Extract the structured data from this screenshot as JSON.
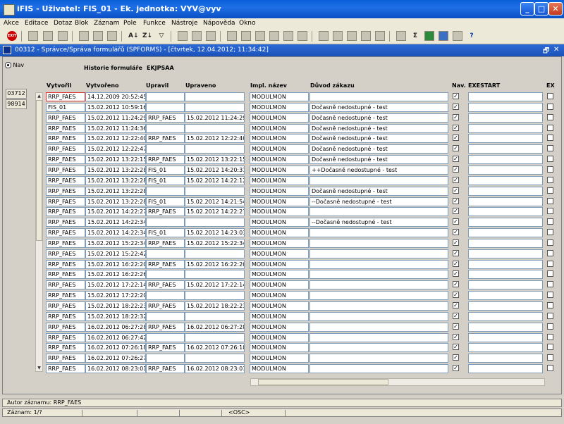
{
  "window": {
    "title": "iFIS - Uživatel: FIS_01 - Ek. jednotka: VYV@vyv",
    "min_label": "_",
    "max_label": "□",
    "close_label": "✕"
  },
  "menu": [
    "Akce",
    "Editace",
    "Dotaz",
    "Blok",
    "Záznam",
    "Pole",
    "Funkce",
    "Nástroje",
    "Nápověda",
    "Okno"
  ],
  "toolbar": {
    "exit_label": "EXIT",
    "sort_asc": "A↓",
    "sort_desc": "Z↓",
    "filter": "▽",
    "sigma": "Σ",
    "help": "?"
  },
  "form": {
    "title": "00312 - Správce/Správa formulářů (SPFORMS) - [čtvrtek, 12.04.2012; 11:34:42]",
    "restore_label": "🗗",
    "close_label": "✕",
    "nav_label": "Nav",
    "left_buttons": [
      "03712",
      "98914"
    ],
    "history_label": "Historie formuláře",
    "history_value": "EKJPSAA"
  },
  "columns": {
    "created_by": "Vytvořil",
    "created": "Vytvořeno",
    "modified_by": "Upravil",
    "modified": "Upraveno",
    "impl_name": "Impl. název",
    "reason": "Důvod zákazu",
    "nav": "Nav.",
    "exestart": "EXESTART",
    "ex": "EX"
  },
  "rows": [
    {
      "created_by": "RRP_FAES",
      "created": "14.12.2009 20:52:45",
      "modified_by": "",
      "modified": "",
      "impl": "MODULMON",
      "reason": ""
    },
    {
      "created_by": "FIS_01",
      "created": "15.02.2012 10:59:16",
      "modified_by": "",
      "modified": "",
      "impl": "MODULMON",
      "reason": "Dočasně nedostupné - test"
    },
    {
      "created_by": "RRP_FAES",
      "created": "15.02.2012 11:24:29",
      "modified_by": "RRP_FAES",
      "modified": "15.02.2012 11:24:29",
      "impl": "MODULMON",
      "reason": "Dočasně nedostupné - test"
    },
    {
      "created_by": "RRP_FAES",
      "created": "15.02.2012 11:24:36",
      "modified_by": "",
      "modified": "",
      "impl": "MODULMON",
      "reason": "Dočasně nedostupné - test"
    },
    {
      "created_by": "RRP_FAES",
      "created": "15.02.2012 12:22:40",
      "modified_by": "RRP_FAES",
      "modified": "15.02.2012 12:22:40",
      "impl": "MODULMON",
      "reason": "Dočasně nedostupné - test"
    },
    {
      "created_by": "RRP_FAES",
      "created": "15.02.2012 12:22:47",
      "modified_by": "",
      "modified": "",
      "impl": "MODULMON",
      "reason": "Dočasně nedostupné - test"
    },
    {
      "created_by": "RRP_FAES",
      "created": "15.02.2012 13:22:15",
      "modified_by": "RRP_FAES",
      "modified": "15.02.2012 13:22:15",
      "impl": "MODULMON",
      "reason": "Dočasně nedostupné - test"
    },
    {
      "created_by": "RRP_FAES",
      "created": "15.02.2012 13:22:28",
      "modified_by": "FIS_01",
      "modified": "15.02.2012 14:20:31",
      "impl": "MODULMON",
      "reason": "++Dočasně nedostupné - test"
    },
    {
      "created_by": "RRP_FAES",
      "created": "15.02.2012 13:22:28",
      "modified_by": "FIS_01",
      "modified": "15.02.2012 14:22:12",
      "impl": "MODULMON",
      "reason": ""
    },
    {
      "created_by": "RRP_FAES",
      "created": "15.02.2012 13:22:28",
      "modified_by": "",
      "modified": "",
      "impl": "MODULMON",
      "reason": "Dočasně nedostupné - test"
    },
    {
      "created_by": "RRP_FAES",
      "created": "15.02.2012 13:22:28",
      "modified_by": "FIS_01",
      "modified": "15.02.2012 14:21:54",
      "impl": "MODULMON",
      "reason": "--Dočasně nedostupné - test"
    },
    {
      "created_by": "RRP_FAES",
      "created": "15.02.2012 14:22:27",
      "modified_by": "RRP_FAES",
      "modified": "15.02.2012 14:22:27",
      "impl": "MODULMON",
      "reason": ""
    },
    {
      "created_by": "RRP_FAES",
      "created": "15.02.2012 14:22:34",
      "modified_by": "",
      "modified": "",
      "impl": "MODULMON",
      "reason": "--Dočasně nedostupné - test"
    },
    {
      "created_by": "RRP_FAES",
      "created": "15.02.2012 14:22:34",
      "modified_by": "FIS_01",
      "modified": "15.02.2012 14:23:03",
      "impl": "MODULMON",
      "reason": ""
    },
    {
      "created_by": "RRP_FAES",
      "created": "15.02.2012 15:22:34",
      "modified_by": "RRP_FAES",
      "modified": "15.02.2012 15:22:34",
      "impl": "MODULMON",
      "reason": ""
    },
    {
      "created_by": "RRP_FAES",
      "created": "15.02.2012 15:22:42",
      "modified_by": "",
      "modified": "",
      "impl": "MODULMON",
      "reason": ""
    },
    {
      "created_by": "RRP_FAES",
      "created": "15.02.2012 16:22:20",
      "modified_by": "RRP_FAES",
      "modified": "15.02.2012 16:22:20",
      "impl": "MODULMON",
      "reason": ""
    },
    {
      "created_by": "RRP_FAES",
      "created": "15.02.2012 16:22:26",
      "modified_by": "",
      "modified": "",
      "impl": "MODULMON",
      "reason": ""
    },
    {
      "created_by": "RRP_FAES",
      "created": "15.02.2012 17:22:14",
      "modified_by": "RRP_FAES",
      "modified": "15.02.2012 17:22:14",
      "impl": "MODULMON",
      "reason": ""
    },
    {
      "created_by": "RRP_FAES",
      "created": "15.02.2012 17:22:20",
      "modified_by": "",
      "modified": "",
      "impl": "MODULMON",
      "reason": ""
    },
    {
      "created_by": "RRP_FAES",
      "created": "15.02.2012 18:22:23",
      "modified_by": "RRP_FAES",
      "modified": "15.02.2012 18:22:23",
      "impl": "MODULMON",
      "reason": ""
    },
    {
      "created_by": "RRP_FAES",
      "created": "15.02.2012 18:22:32",
      "modified_by": "",
      "modified": "",
      "impl": "MODULMON",
      "reason": ""
    },
    {
      "created_by": "RRP_FAES",
      "created": "16.02.2012 06:27:28",
      "modified_by": "RRP_FAES",
      "modified": "16.02.2012 06:27:28",
      "impl": "MODULMON",
      "reason": ""
    },
    {
      "created_by": "RRP_FAES",
      "created": "16.02.2012 06:27:42",
      "modified_by": "",
      "modified": "",
      "impl": "MODULMON",
      "reason": ""
    },
    {
      "created_by": "RRP_FAES",
      "created": "16.02.2012 07:26:18",
      "modified_by": "RRP_FAES",
      "modified": "16.02.2012 07:26:18",
      "impl": "MODULMON",
      "reason": ""
    },
    {
      "created_by": "RRP_FAES",
      "created": "16.02.2012 07:26:27",
      "modified_by": "",
      "modified": "",
      "impl": "MODULMON",
      "reason": ""
    },
    {
      "created_by": "RRP_FAES",
      "created": "16.02.2012 08:23:01",
      "modified_by": "RRP_FAES",
      "modified": "16.02.2012 08:23:01",
      "impl": "MODULMON",
      "reason": ""
    }
  ],
  "check_mark": "✓",
  "scroll": {
    "up": "▲",
    "down": "▼",
    "left": "◄",
    "right": "►"
  },
  "status": {
    "author": "Autor záznamu: RRP_FAES",
    "record": "Záznam: 1/?",
    "mode": "<OSC>"
  },
  "icons": [
    "exit-icon",
    "open-icon",
    "print-icon",
    "query-icon",
    "sort-asc-icon",
    "sort-desc-icon",
    "filter-icon",
    "calculator-icon",
    "excel-icon",
    "help-icon"
  ]
}
